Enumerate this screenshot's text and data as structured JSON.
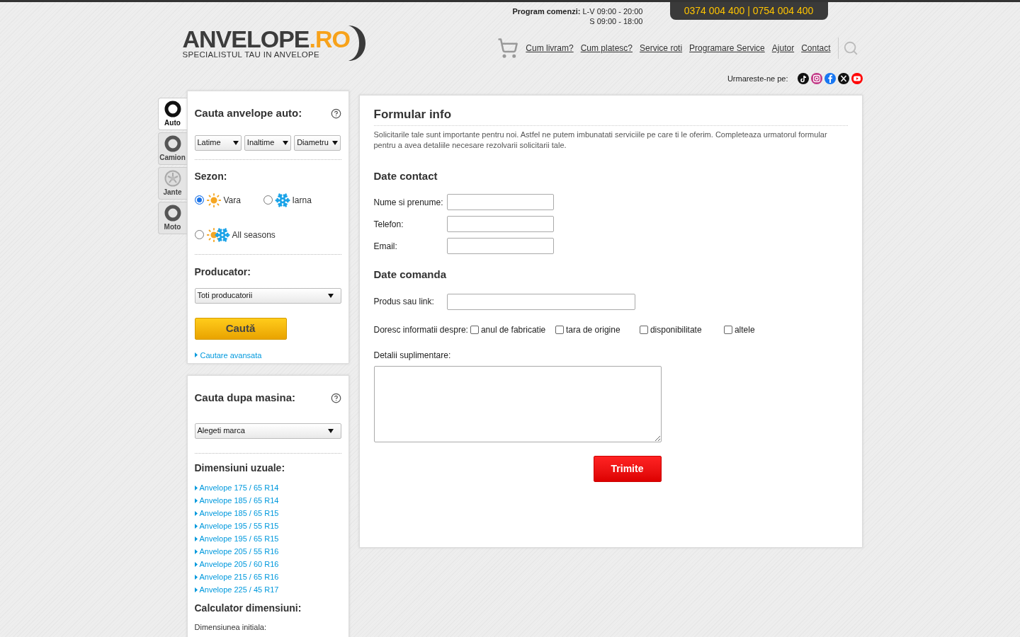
{
  "header": {
    "logo": {
      "name": "ANVELOPE",
      "suffix": ".RO",
      "tagline": "SPECIALISTUL TAU IN ANVELOPE"
    },
    "schedule": {
      "label": "Program comenzi:",
      "weekdays": "L-V 09:00 - 20:00",
      "saturday": "S 09:00 - 18:00"
    },
    "phones": "0374 004 400 | 0754 004 400",
    "nav": [
      "Cum livram?",
      "Cum platesc?",
      "Service roti",
      "Programare Service",
      "Ajutor",
      "Contact"
    ],
    "follow_label": "Urmareste-ne pe:",
    "socials": [
      {
        "kind": "tiktok",
        "color": "#111111"
      },
      {
        "kind": "instagram",
        "color": "#c13584"
      },
      {
        "kind": "facebook",
        "color": "#1877f2"
      },
      {
        "kind": "x",
        "color": "#111111"
      },
      {
        "kind": "youtube",
        "color": "#ff0000"
      }
    ]
  },
  "vehicle_tabs": [
    {
      "label": "Auto",
      "kind": "tire",
      "selected": true
    },
    {
      "label": "Camion",
      "kind": "tire",
      "selected": false
    },
    {
      "label": "Jante",
      "kind": "rim",
      "selected": false
    },
    {
      "label": "Moto",
      "kind": "tire",
      "selected": false
    }
  ],
  "tire_search": {
    "title": "Cauta anvelope auto:",
    "selects": [
      "Latime",
      "Inaltime",
      "Diametru"
    ],
    "season_label": "Sezon:",
    "seasons": [
      {
        "label": "Vara",
        "kind": "summer",
        "selected": true
      },
      {
        "label": "Iarna",
        "kind": "winter",
        "selected": false
      },
      {
        "label": "All seasons",
        "kind": "all",
        "selected": false
      }
    ],
    "maker_label": "Producator:",
    "maker_select": "Toti producatorii",
    "search_button": "Caută",
    "advanced_link": "Cautare avansata"
  },
  "car_search": {
    "title": "Cauta dupa masina:",
    "brand_select": "Alegeti marca",
    "common_title": "Dimensiuni uzuale:",
    "common_sizes": [
      "Anvelope 175 / 65 R14",
      "Anvelope 185 / 65 R14",
      "Anvelope 185 / 65 R15",
      "Anvelope 195 / 55 R15",
      "Anvelope 195 / 65 R15",
      "Anvelope 205 / 55 R16",
      "Anvelope 205 / 60 R16",
      "Anvelope 215 / 65 R16",
      "Anvelope 225 / 45 R17"
    ],
    "calculator_title": "Calculator dimensiuni:",
    "initial_label": "Dimensiunea initiala:"
  },
  "form": {
    "title": "Formular info",
    "intro": "Solicitarile tale sunt importante pentru noi. Astfel ne putem imbunatati serviciile pe care ti le oferim. Completeaza urmatorul formular pentru a avea detaliile necesare rezolvarii solicitarii tale.",
    "contact_title": "Date contact",
    "contact_fields": [
      "Nume si prenume:",
      "Telefon:",
      "Email:"
    ],
    "order_title": "Date comanda",
    "product_label": "Produs sau link:",
    "info_label": "Doresc informatii despre:",
    "info_options": [
      {
        "label": "anul de fabricatie",
        "checked": false
      },
      {
        "label": "tara de origine",
        "checked": false
      },
      {
        "label": "disponibilitate",
        "checked": false
      },
      {
        "label": "altele",
        "checked": false
      }
    ],
    "details_label": "Detalii suplimentare:",
    "submit": "Trimite"
  }
}
